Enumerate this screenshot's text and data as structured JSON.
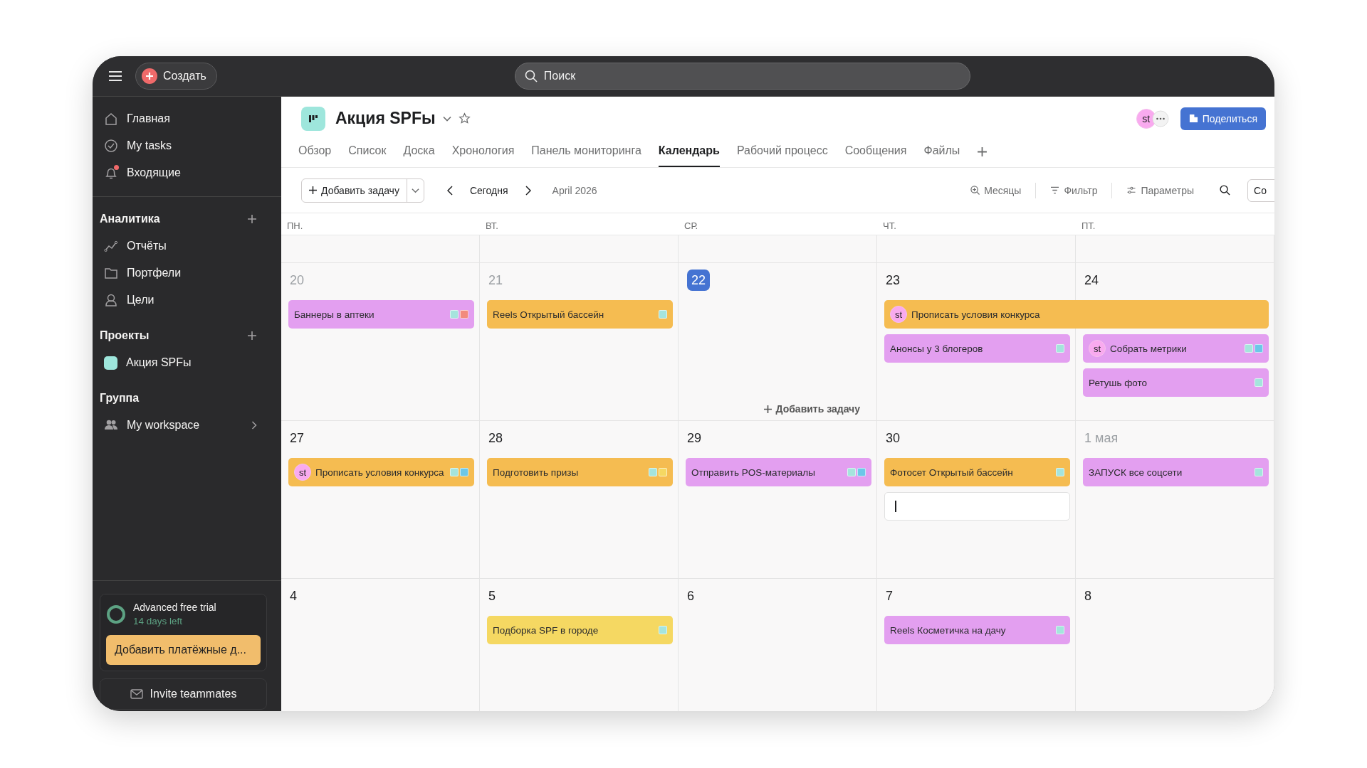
{
  "topbar": {
    "create_label": "Создать",
    "search_placeholder": "Поиск"
  },
  "sidebar": {
    "nav": [
      {
        "label": "Главная",
        "badge": false
      },
      {
        "label": "My tasks",
        "badge": false
      },
      {
        "label": "Входящие",
        "badge": true
      }
    ],
    "sections": [
      {
        "title": "Аналитика",
        "add": true,
        "items": [
          {
            "label": "Отчёты",
            "chevron": false
          },
          {
            "label": "Портфели",
            "chevron": false
          },
          {
            "label": "Цели",
            "chevron": false
          }
        ]
      },
      {
        "title": "Проекты",
        "add": true,
        "items": [
          {
            "label": "Акция SPFы",
            "color": "#9ee6dc",
            "chevron": false
          }
        ]
      },
      {
        "title": "Группа",
        "add": false,
        "items": [
          {
            "label": "My workspace",
            "chevron": true
          }
        ]
      }
    ],
    "trial": {
      "title": "Advanced free trial",
      "subtitle": "14 days left",
      "button": "Добавить платёжные д..."
    },
    "invite": "Invite teammates"
  },
  "header": {
    "title": "Акция SPFы",
    "avatar": "st",
    "share": "Поделиться"
  },
  "tabs": [
    {
      "label": "Обзор",
      "selected": false
    },
    {
      "label": "Список",
      "selected": false
    },
    {
      "label": "Доска",
      "selected": false
    },
    {
      "label": "Хронология",
      "selected": false
    },
    {
      "label": "Панель мониторинга",
      "selected": false
    },
    {
      "label": "Календарь",
      "selected": true
    },
    {
      "label": "Рабочий процесс",
      "selected": false
    },
    {
      "label": "Сообщения",
      "selected": false
    },
    {
      "label": "Файлы",
      "selected": false
    }
  ],
  "toolbar": {
    "add_task": "Добавить задачу",
    "today": "Сегодня",
    "period": "April 2026",
    "views": [
      "Месяцы",
      "Фильтр",
      "Параметры"
    ],
    "cut_button": "Со"
  },
  "calendar": {
    "weekdays": [
      "ПН.",
      "ВТ.",
      "СР.",
      "ЧТ.",
      "ПТ."
    ],
    "weeks": [
      {
        "days": [
          {
            "date": "20",
            "muted": true,
            "today": false,
            "tasks": [
              {
                "kind": "task",
                "title": "Баннеры в аптеки",
                "color": "#e39ff0",
                "tags": [
                  {
                    "color": "#a5e4dd"
                  },
                  {
                    "color": "#f28b7d"
                  }
                ]
              }
            ]
          },
          {
            "date": "21",
            "muted": true,
            "today": false,
            "tasks": [
              {
                "kind": "task",
                "title": "Reels Открытый бассейн",
                "color": "#f5bc51",
                "tags": [
                  {
                    "color": "#a5e4dd"
                  }
                ]
              }
            ]
          },
          {
            "date": "22",
            "muted": false,
            "today": true,
            "add_task": "Добавить задачу"
          },
          {
            "date": "23",
            "muted": false,
            "today": false,
            "tasks": [
              {
                "kind": "multi_day",
                "title": "Прописать условия конкурса",
                "color": "#f5bc51",
                "assignee": "st"
              },
              {
                "kind": "task",
                "title": "Анонсы у 3 блогеров",
                "color": "#e39ff0",
                "tags": [
                  {
                    "color": "#a5e4dd"
                  }
                ]
              }
            ]
          },
          {
            "date": "24",
            "muted": false,
            "today": false,
            "tasks": [
              {
                "kind": "task",
                "title": "Собрать метрики",
                "color": "#e39ff0",
                "assignee": "st",
                "tags": [
                  {
                    "color": "#a5e4dd"
                  },
                  {
                    "color": "#6cc7e8"
                  }
                ]
              },
              {
                "kind": "task",
                "title": "Ретушь фото",
                "color": "#e39ff0",
                "tags": [
                  {
                    "color": "#a5e4dd"
                  }
                ]
              }
            ]
          }
        ]
      },
      {
        "days": [
          {
            "date": "27",
            "muted": false,
            "today": false,
            "tasks": [
              {
                "kind": "task",
                "title": "Прописать условия конкурса",
                "color": "#f5bc51",
                "assignee": "st",
                "tags": [
                  {
                    "color": "#a5e4dd"
                  },
                  {
                    "color": "#6cc7e8"
                  }
                ]
              }
            ]
          },
          {
            "date": "28",
            "muted": false,
            "today": false,
            "tasks": [
              {
                "kind": "task",
                "title": "Подготовить призы",
                "color": "#f5bc51",
                "tags": [
                  {
                    "color": "#a5e4dd"
                  },
                  {
                    "color": "#f5d862"
                  }
                ]
              }
            ]
          },
          {
            "date": "29",
            "muted": false,
            "today": false,
            "tasks": [
              {
                "kind": "task",
                "title": "Отправить POS-материалы",
                "color": "#e39ff0",
                "tags": [
                  {
                    "color": "#a5e4dd"
                  },
                  {
                    "color": "#6cc7e8"
                  }
                ]
              }
            ]
          },
          {
            "date": "30",
            "muted": false,
            "today": false,
            "tasks": [
              {
                "kind": "task",
                "title": "Фотосет Открытый бассейн",
                "color": "#f5bc51",
                "tags": [
                  {
                    "color": "#a5e4dd"
                  }
                ]
              },
              {
                "kind": "new_task"
              }
            ]
          },
          {
            "date": "1 мая",
            "muted": true,
            "today": false,
            "tasks": [
              {
                "kind": "task",
                "title": "ЗАПУСК все соцсети",
                "color": "#e39ff0",
                "tags": [
                  {
                    "color": "#a5e4dd"
                  }
                ]
              }
            ]
          }
        ]
      },
      {
        "days": [
          {
            "date": "4",
            "muted": false,
            "today": false
          },
          {
            "date": "5",
            "muted": false,
            "today": false,
            "tasks": [
              {
                "kind": "task",
                "title": "Подборка SPF в городе",
                "color": "#f5d862",
                "tags": [
                  {
                    "color": "#a5e4dd"
                  }
                ]
              }
            ]
          },
          {
            "date": "6",
            "muted": false,
            "today": false
          },
          {
            "date": "7",
            "muted": false,
            "today": false,
            "tasks": [
              {
                "kind": "task",
                "title": "Reels Косметичка на дачу",
                "color": "#e39ff0",
                "tags": [
                  {
                    "color": "#a5e4dd"
                  }
                ]
              }
            ]
          },
          {
            "date": "8",
            "muted": false,
            "today": false
          }
        ]
      }
    ]
  }
}
